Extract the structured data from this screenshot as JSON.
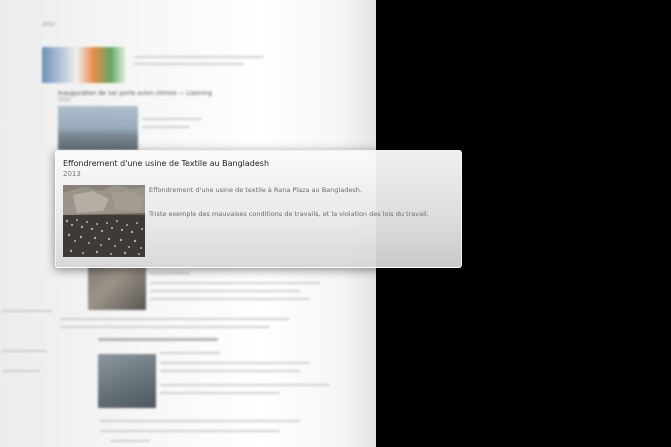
{
  "card": {
    "title": "Effondrement d'une usine de Textile au Bangladesh",
    "year": "2013",
    "description_1": "Effondrement d'une usine de textile à Rana Plaza au Bangladesh.",
    "description_2": "Triste exemple des mauvaises conditions de travails, et la violation des lois du travail."
  },
  "background_items": [
    {
      "title": "",
      "year": "2012"
    },
    {
      "title": "Inauguration de 1er porte avion chinois — Liaoning",
      "year": "2012"
    },
    {
      "title": "",
      "year": ""
    },
    {
      "title": "",
      "year": ""
    }
  ],
  "colors": {
    "backdrop": "#000000",
    "page": "#f6f6f6",
    "card_top": "#fafafa",
    "card_bottom": "#d6d6d6"
  }
}
